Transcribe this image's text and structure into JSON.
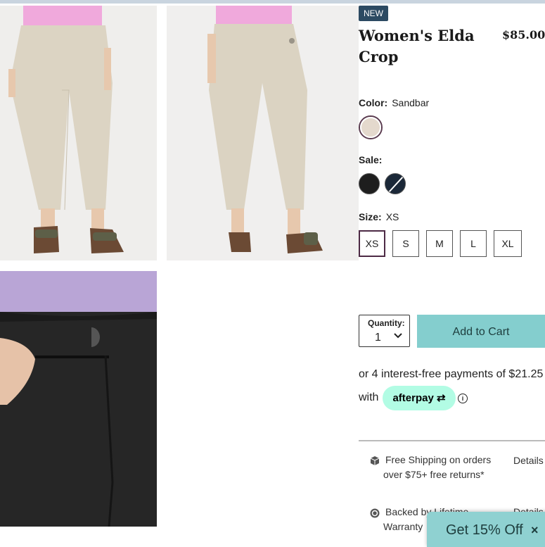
{
  "product": {
    "badge": "NEW",
    "title": "Women's Elda Crop",
    "price": "$85.00"
  },
  "color": {
    "label": "Color:",
    "value": "Sandbar",
    "swatches": [
      {
        "name": "Sandbar",
        "hex": "#e4d9cd"
      }
    ]
  },
  "sale": {
    "label": "Sale:",
    "swatches": [
      {
        "hex": "#1e1e1e"
      },
      {
        "hex": "#1b2838"
      }
    ]
  },
  "size": {
    "label": "Size:",
    "value": "XS",
    "options": [
      "XS",
      "S",
      "M",
      "L",
      "XL"
    ]
  },
  "quantity": {
    "label": "Quantity:",
    "value": "1"
  },
  "cart": {
    "button_label": "Add to Cart"
  },
  "afterpay": {
    "text": "or 4 interest-free payments of $21.25",
    "with": "with",
    "brand": "afterpay",
    "info_icon": "i"
  },
  "perks": [
    {
      "icon": "box-icon",
      "line1": "Free Shipping on orders",
      "line2": "over $75+ free returns*",
      "details": "Details"
    },
    {
      "icon": "badge-icon",
      "line1": "Backed by Lifetime",
      "line2": "Warranty",
      "details": "Details"
    }
  ],
  "promo": {
    "label": "Get 15% Off",
    "close": "×"
  },
  "colors": {
    "accent": "#84cece",
    "badge": "#2c4a62",
    "afterpay": "#b2fce4"
  }
}
